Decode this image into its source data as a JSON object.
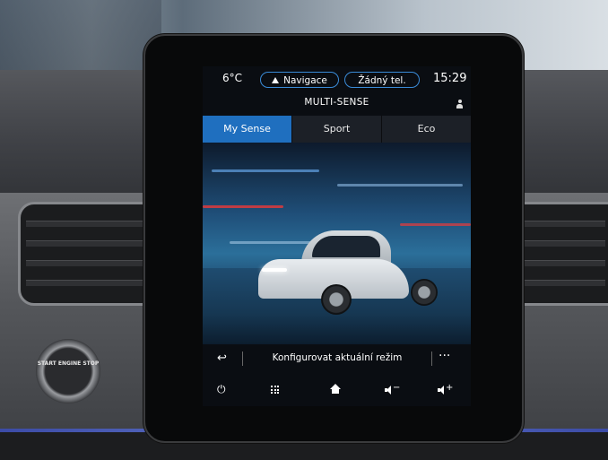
{
  "status": {
    "temperature": "6°C",
    "navigation_label": "Navigace",
    "phone_label": "Žádný tel.",
    "time": "15:29"
  },
  "multisense": {
    "title": "MULTI-SENSE",
    "tabs": [
      {
        "label": "My Sense",
        "active": true
      },
      {
        "label": "Sport",
        "active": false
      },
      {
        "label": "Eco",
        "active": false
      }
    ],
    "config_label": "Konfigurovat aktuální režim",
    "more_label": "···"
  },
  "start_button": {
    "text": "START ENGINE STOP"
  },
  "icons": {
    "back": "back-arrow-icon",
    "power": "power-icon",
    "apps": "apps-grid-icon",
    "home": "home-icon",
    "volume_down": "volume-down-icon",
    "volume_up": "volume-up-icon",
    "profile": "profile-icon"
  },
  "colors": {
    "accent": "#1f6fbf",
    "pill_border": "#3a8bd8",
    "ambient_light": "#6f8cff"
  }
}
